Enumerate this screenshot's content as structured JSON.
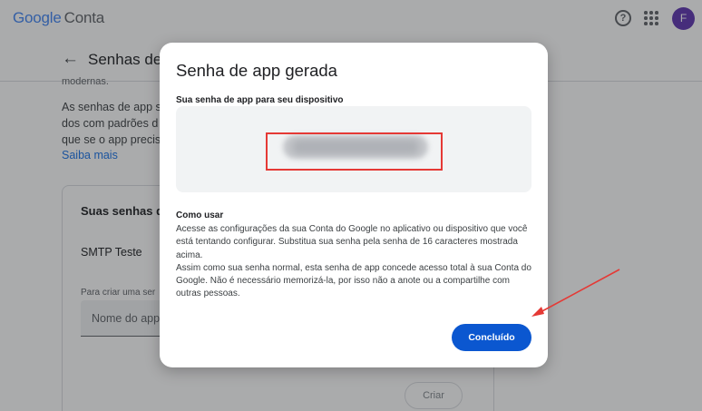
{
  "header": {
    "logo_google": "Google",
    "logo_conta": "Conta",
    "avatar_letter": "F"
  },
  "subheader": {
    "title": "Senhas de",
    "cut_text": "modernas."
  },
  "background": {
    "para_lines": [
      "As senhas de app s",
      "dos com padrões d",
      "que se o app precis"
    ],
    "link": "Saiba mais",
    "card_title": "Suas senhas de",
    "app_name": "SMTP Teste",
    "create_hint": "Para criar uma ser",
    "input_placeholder": "Nome do app",
    "create_button": "Criar"
  },
  "dialog": {
    "title": "Senha de app gerada",
    "subtitle": "Sua senha de app para seu dispositivo",
    "howto_title": "Como usar",
    "howto_p1": "Acesse as configurações da sua Conta do Google no aplicativo ou dispositivo que você está tentando configurar. Substitua sua senha pela senha de 16 caracteres mostrada acima.",
    "howto_p2": "Assim como sua senha normal, esta senha de app concede acesso total à sua Conta do Google. Não é necessário memorizá-la, por isso não a anote ou a compartilhe com outras pessoas.",
    "done_button": "Concluído"
  },
  "colors": {
    "primary_button": "#0b57d0",
    "highlight_box": "#e53935",
    "avatar": "#5e35b1"
  },
  "icons": [
    "help-icon",
    "apps-grid-icon",
    "back-arrow-icon"
  ]
}
